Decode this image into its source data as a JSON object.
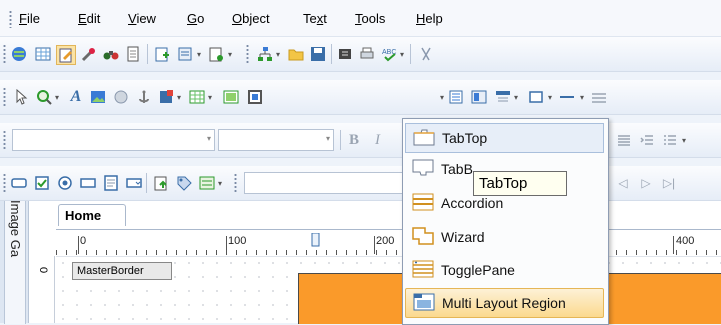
{
  "menubar": {
    "items": [
      {
        "label": "File",
        "accel": "F",
        "rest": "ile"
      },
      {
        "label": "Edit",
        "accel": "E",
        "rest": "dit"
      },
      {
        "label": "View",
        "accel": "V",
        "rest": "iew"
      },
      {
        "label": "Go",
        "accel": "G",
        "rest": "o"
      },
      {
        "label": "Object",
        "accel": "O",
        "rest": "bject"
      },
      {
        "label": "Text",
        "accel": "",
        "rest": "Te",
        "accel2": "x",
        "rest2": "t"
      },
      {
        "label": "Tools",
        "accel": "T",
        "rest": "ools"
      },
      {
        "label": "Help",
        "accel": "H",
        "rest": "elp"
      }
    ]
  },
  "toolbar_format": {
    "bold_label": "B",
    "italic_label": "I"
  },
  "editor": {
    "side_tab_label": "Image Ga",
    "doc_tab_label": "Home",
    "ruler_marks": [
      "0",
      "100",
      "200",
      "400"
    ],
    "vruler_mark": "0",
    "master_border_label": "MasterBorder"
  },
  "dropdown": {
    "items": [
      {
        "label": "TabTop",
        "icon": "tabtop-icon",
        "highlighted": false
      },
      {
        "label": "TabBottom",
        "icon": "tabbottom-icon",
        "highlighted": false
      },
      {
        "label": "Accordion",
        "icon": "accordion-icon",
        "highlighted": false
      },
      {
        "label": "Wizard",
        "icon": "wizard-icon",
        "highlighted": false
      },
      {
        "label": "TogglePane",
        "icon": "togglepane-icon",
        "highlighted": false
      },
      {
        "label": "Multi Layout Region",
        "icon": "multi-layout-region-icon",
        "highlighted": true
      }
    ],
    "tooltip": "TabTop",
    "visible_partial_item": "TabB"
  },
  "colors": {
    "accent_orange": "#fa9a2a",
    "highlight": "#fbd98e"
  }
}
